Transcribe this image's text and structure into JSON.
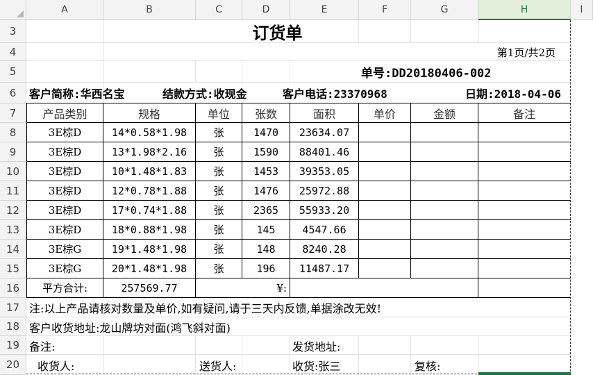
{
  "columns": [
    "A",
    "B",
    "C",
    "D",
    "E",
    "F",
    "G",
    "H",
    "I"
  ],
  "rows": [
    "3",
    "4",
    "5",
    "6",
    "7",
    "8",
    "9",
    "10",
    "11",
    "12",
    "13",
    "14",
    "15",
    "16",
    "17",
    "18",
    "19",
    "20"
  ],
  "title": "订货单",
  "page_info": "第1页/共2页",
  "order_no": "单号:DD20180406-002",
  "info": {
    "customer": "客户简称:华西名宝",
    "payment": "结款方式:收现金",
    "phone": "客户电话:23370968",
    "date": "日期:2018-04-06"
  },
  "table": {
    "headers": [
      "产品类别",
      "规格",
      "单位",
      "张数",
      "面积",
      "单价",
      "金额",
      "备注"
    ],
    "rows": [
      [
        "3E棕D",
        "14*0.58*1.98",
        "张",
        "1470",
        "23634.07"
      ],
      [
        "3E棕D",
        "13*1.98*2.16",
        "张",
        "1590",
        "88401.46"
      ],
      [
        "3E棕D",
        "10*1.48*1.83",
        "张",
        "1453",
        "39353.05"
      ],
      [
        "3E棕D",
        "12*0.78*1.88",
        "张",
        "1476",
        "25972.88"
      ],
      [
        "3E棕D",
        "17*0.74*1.88",
        "张",
        "2365",
        "55933.20"
      ],
      [
        "3E棕D",
        "18*0.88*1.98",
        "张",
        "145",
        "4547.66"
      ],
      [
        "3E棕G",
        "19*1.48*1.98",
        "张",
        "148",
        "8240.28"
      ],
      [
        "3E棕G",
        "20*1.48*1.98",
        "张",
        "196",
        "11487.17"
      ]
    ]
  },
  "total": {
    "label": "平方合计:",
    "value": "257569.77",
    "currency": "¥:"
  },
  "note": "注:以上产品请核对数量及单价,如有疑问,请于三天内反馈,单据涂改无效!",
  "address": "客户收货地址:龙山牌坊对面(鸿飞斜对面)",
  "remark": "备注:",
  "ship_address": "发货地址:",
  "footer": {
    "receiver": "收货人:",
    "deliverer": "送货人:",
    "receipt": "收货:张三",
    "review": "复核:"
  },
  "colors": {
    "header_bg": "#f3f3f3",
    "selected": "#217346",
    "gridline": "#e1e1e1"
  }
}
